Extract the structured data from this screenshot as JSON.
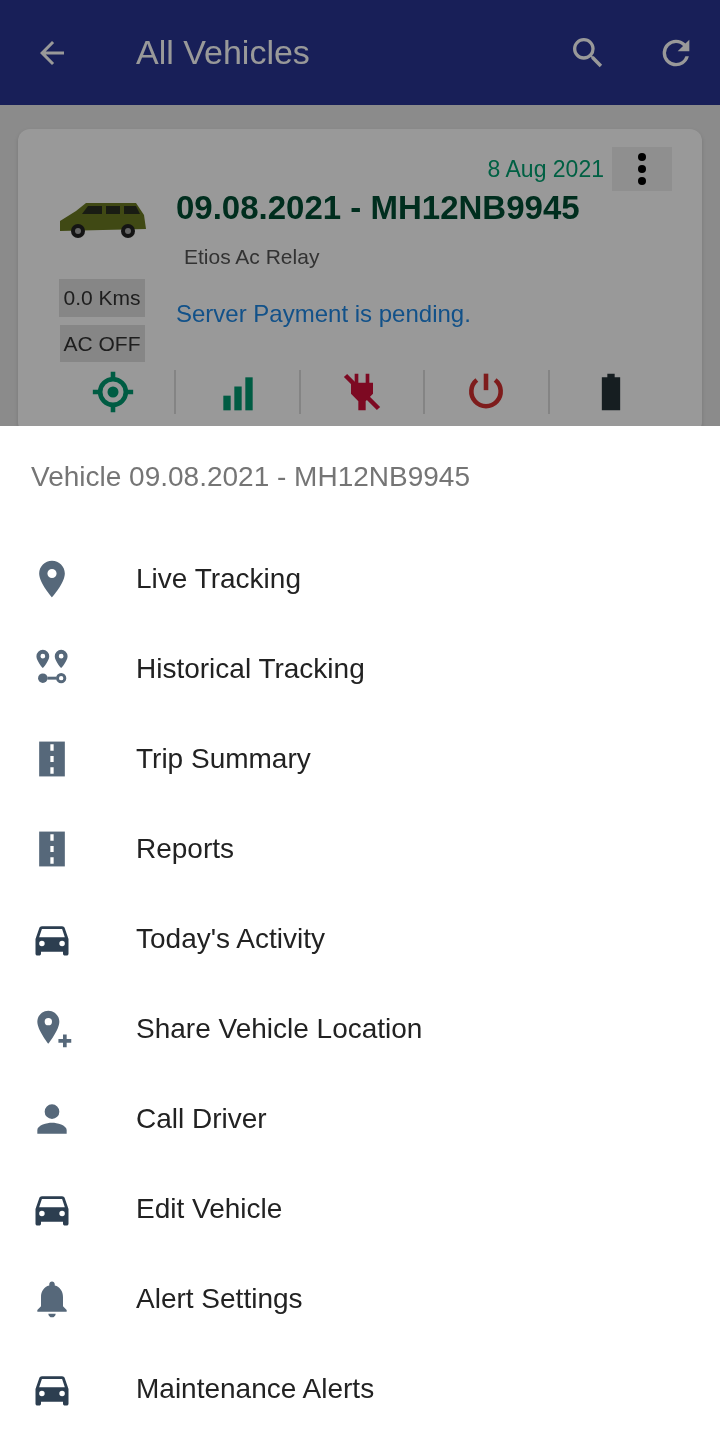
{
  "app_bar": {
    "title": "All Vehicles"
  },
  "vehicle_card": {
    "date": "8 Aug 2021",
    "name": "09.08.2021 - MH12NB9945",
    "model": "Etios Ac Relay",
    "distance": "0.0 Kms",
    "ac_status": "AC OFF",
    "message": "Server Payment is pending."
  },
  "sheet": {
    "title": "Vehicle 09.08.2021 - MH12NB9945",
    "items": [
      {
        "label": "Live Tracking"
      },
      {
        "label": "Historical Tracking"
      },
      {
        "label": "Trip Summary"
      },
      {
        "label": "Reports"
      },
      {
        "label": "Today's Activity"
      },
      {
        "label": "Share Vehicle Location"
      },
      {
        "label": "Call Driver"
      },
      {
        "label": "Edit Vehicle"
      },
      {
        "label": "Alert Settings"
      },
      {
        "label": "Maintenance Alerts"
      }
    ]
  }
}
